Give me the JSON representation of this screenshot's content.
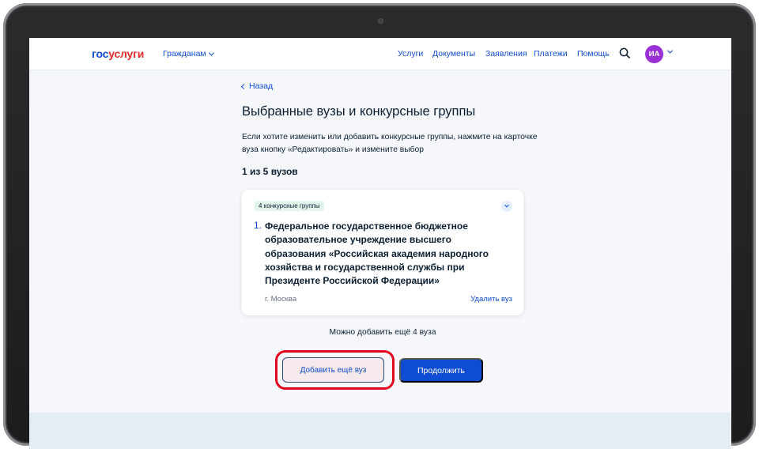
{
  "header": {
    "logo_part1": "гос",
    "logo_part2": "услуги",
    "citizens_label": "Гражданам",
    "nav": [
      "Услуги",
      "Документы",
      "Заявления",
      "Платежи",
      "Помощь"
    ],
    "avatar_initials": "ИА"
  },
  "page": {
    "back_label": "Назад",
    "title": "Выбранные вузы и конкурсные группы",
    "description": "Если хотите изменить или добавить конкурсные группы, нажмите на карточке вуза кнопку «Редактировать» и измените выбор",
    "count": "1 из 5 вузов"
  },
  "card": {
    "badge": "4 конкурсные группы",
    "number": "1.",
    "university": "Федеральное государственное бюджетное образовательное учреждение высшего образования «Российская академия народного хозяйства и государственной службы при Президенте Российской Федерации»",
    "city": "г. Москва",
    "remove_label": "Удалить вуз"
  },
  "footer": {
    "more_text": "Можно добавить ещё 4 вуза",
    "add_button": "Добавить ещё вуз",
    "continue_button": "Продолжить"
  },
  "colors": {
    "accent": "#0d4cd3",
    "logo_red": "#e52d2d",
    "avatar": "#9b2fd6",
    "highlight": "#e3001b"
  }
}
